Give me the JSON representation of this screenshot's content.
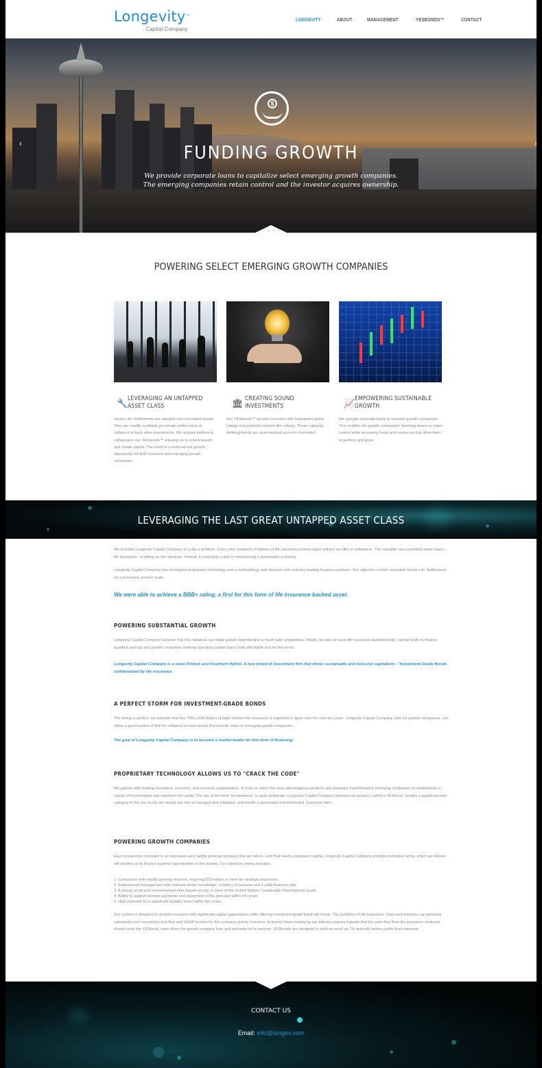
{
  "header": {
    "logo_main": "Longevity",
    "logo_tm": "™",
    "logo_sub": "Capital Company",
    "nav": [
      "LONGEVITY",
      "ABOUT",
      "MANAGEMENT",
      "YESBONDS™",
      "CONTACT"
    ]
  },
  "hero": {
    "icon_symbol": "$",
    "title": "FUNDING GROWTH",
    "subtitle_line1": "We provide corporate loans to capitalize select emerging growth companies.",
    "subtitle_line2": "The emerging companies retain control and the investor acquires ownership.",
    "prev_arrow": "‹",
    "next_arrow": "›",
    "dots": "• • •"
  },
  "powering": {
    "title": "POWERING SELECT EMERGING GROWTH COMPANIES",
    "cards": [
      {
        "icon": "wrench-icon",
        "title": "LEVERAGING AN UNTAPPED ASSET CLASS",
        "text": "Senior Life Settlements are valuable non-correlated assets. They are readily available yet remain under-used as collateral to back other investments. We acquire policies to collateralize our YESbonds™ allowing us to unlock wealth and create capital. The result is a reduced-risk growth opportunity for both investors and emerging growth companies."
      },
      {
        "icon": "bank-icon",
        "title": "CREATING SOUND INVESTMENTS",
        "text": "Our YESbonds™ provide investors with investment grade ratings and potential venture-like returns. These category-defining bonds are asset-backed and non-correlated."
      },
      {
        "icon": "chart-icon",
        "title": "EMPOWERING SUSTAINABLE GROWTH",
        "text": "We provide corporate loans to selected growth companies. This enables the growth companies' founding teams to retain control while accessing funds and resources that allow them to perform and grow."
      }
    ]
  },
  "banner": {
    "title": "LEVERAGING THE LAST GREAT UNTAPPED ASSET CLASS"
  },
  "content": {
    "intro_p1": "We founded Longevity Capital Company to solve a problem. Every year hundreds of billions of life insurance policies lapse without an offer or settlement. This valuable non-correlated asset class—life insurance—is sitting on the sidelines. Instead, it could play a part in empowering a sustainable economy.",
    "intro_p2": "Longevity Capital Company has developed proprietary technology and a methodology and structure with industry-leading business partners. Our objective is bold: securitize Senior Life Settlements on a previously unseen scale.",
    "intro_highlight": "We were able to achieve a BBB+ rating, a first for this form of life insurance-backed asset.",
    "s1_heading": "POWERING SUBSTANTIAL GROWTH",
    "s1_text": "Longevity Capital Company believes that this collateral can make growth opportunities a much safer proposition. Initially, we plan to issue life insurance-backed bonds, raising funds to finance qualified start-up and growth companies seeking operating capital that is both affordable and no lien terms.",
    "s1_highlight": "Longevity Capital Company is a novel Fintech and Insurtech Hybrid. A new breed of investment firm that drives sustainable and inclusive capitalism—\"Investment-Grade Bonds collateralized by life insurance.",
    "s2_heading": "A PERFECT STORM FOR INVESTMENT-GRADE BONDS",
    "s2_text": "The timing is perfect: we estimate that four TRILLION dollars of baby boomer life insurance is expected to lapse over the next ten years. Longevity Capital Company, and our partner companies, can utilize a good portion of that for collateral to back bonds that provide loans to emerging growth companies.",
    "s2_highlight": "The goal of Longevity Capital Company is to become a market leader for this form of financing.",
    "s3_heading": "PROPRIETARY TECHNOLOGY ALLOWS US TO \"CRACK THE CODE\"",
    "s3_text": "We partner with leading incubators, investors, and research organizations, to help us select the most advantageous projects and empower transformative emerging companies to revolutionize a variety of technologies and transform the world. The use of the term \"revolutionize\" is quite deliberate. Longevity Capital Company believes our product, called a YESbond, heralds a significant new category in the way funds are raised, the risk is managed and mitigated, and wealth is generated and distributed. Everyone wins.",
    "s4_heading": "POWERING GROWTH COMPANIES",
    "s4_text": "Each prospective borrower is an innovative and rapidly growing company that we select—one that needs expansion capital. Longevity Capital Company provides favorable terms, which we believe will position us to finance superior opportunities in the market. Our selection criteria includes:",
    "s4_list": [
      "1. Companies with rapidly growing revenue, requiring $15 million or more for strategic expansion",
      "2. Experienced management with relevant sector knowledge, a history of success and a solid business plan",
      "3. A strong social and environmental ethic based on one or more of the United Nations Sustainable Development Goals",
      "4. Ability to support interest payments and repayment of the principal within ten years",
      "5. High potential for a significant liquidity event within five years"
    ],
    "s4_closing": "Our system is designed to provide investors with significant capital appreciation while offering investment-grade bond risk levels. The portfolios of life insurance, loans and warrants can generate substantial and consistent cash flow and GAAP income for the company and its investors. Actuarial stress testing by top industry experts indicate that the cash flow from the insurance contracts should retire the YESbond, even when the growth company loan and warrants fail to perform. YESbonds are designed to yield as much as 7% annually before profits from warrants."
  },
  "footer": {
    "title": "CONTACT US",
    "email_label": "Email:",
    "email": "info@longev.com"
  },
  "colors": {
    "accent": "#1f8fd0",
    "banner_bg": "#050b0d"
  }
}
